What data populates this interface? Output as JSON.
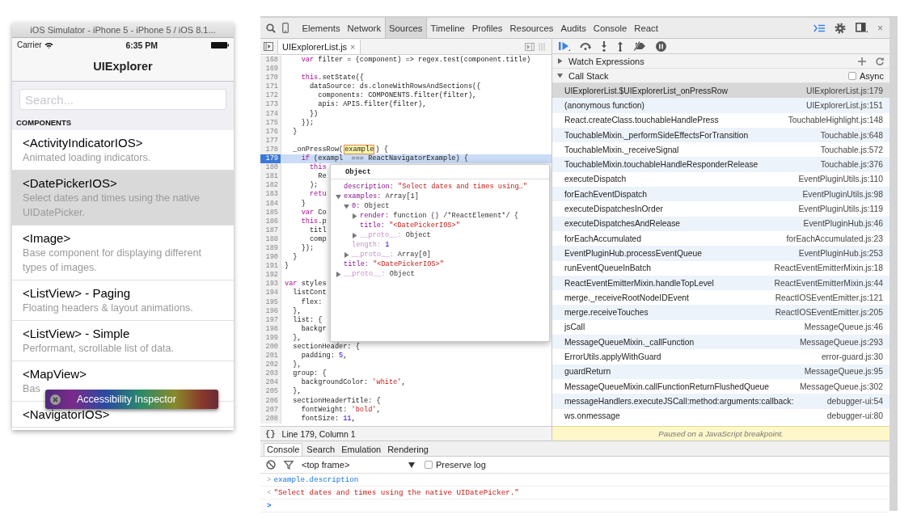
{
  "simulator": {
    "title": "iOS Simulator - iPhone 5 - iPhone 5 / iOS 8.1...",
    "status_bar": {
      "carrier": "Carrier",
      "time": "6:35 PM"
    },
    "nav_title": "UIExplorer",
    "search": {
      "placeholder": "Search..."
    },
    "section_header": "COMPONENTS",
    "items": [
      {
        "title": "<ActivityIndicatorIOS>",
        "description": "Animated loading indicators.",
        "selected": false
      },
      {
        "title": "<DatePickerIOS>",
        "description": "Select dates and times using the native UIDatePicker.",
        "selected": true
      },
      {
        "title": "<Image>",
        "description": "Base component for displaying different types of images.",
        "selected": false
      },
      {
        "title": "<ListView> - Paging",
        "description": "Floating headers & layout animations.",
        "selected": false
      },
      {
        "title": "<ListView> - Simple",
        "description": "Performant, scrollable list of data.",
        "selected": false
      },
      {
        "title": "<MapView>",
        "description": "Bas",
        "selected": false
      },
      {
        "title": "<NavigatorIOS>",
        "selected": false
      }
    ],
    "overlay": {
      "label": "Accessibility Inspector"
    }
  },
  "devtools": {
    "tabs": [
      {
        "label": "Elements",
        "selected": false
      },
      {
        "label": "Network",
        "selected": false
      },
      {
        "label": "Sources",
        "selected": true
      },
      {
        "label": "Timeline",
        "selected": false
      },
      {
        "label": "Profiles",
        "selected": false
      },
      {
        "label": "Resources",
        "selected": false
      },
      {
        "label": "Audits",
        "selected": false
      },
      {
        "label": "Console",
        "selected": false
      },
      {
        "label": "React",
        "selected": false
      }
    ],
    "close": "×",
    "file_tab": {
      "name": "UIExplorerList.js",
      "close": "×"
    },
    "editor": {
      "lines": [
        {
          "number": "168",
          "current": false,
          "tokens": [
            {
              "text": "    var",
              "kind": "keyword"
            },
            {
              "text": " filter = (component) => regex.test(component.title)",
              "kind": "plain"
            }
          ]
        },
        {
          "number": "169",
          "current": false
        },
        {
          "number": "170",
          "current": false,
          "tokens": [
            {
              "text": "    this",
              "kind": "keyword"
            },
            {
              "text": ".setState({",
              "kind": "plain"
            }
          ]
        },
        {
          "number": "171",
          "current": false,
          "tokens": [
            {
              "text": "      dataSource: ds.cloneWithRowsAndSections({",
              "kind": "plain"
            }
          ]
        },
        {
          "number": "172",
          "current": false,
          "tokens": [
            {
              "text": "        components: COMPONENTS.filter(filter),",
              "kind": "plain"
            }
          ]
        },
        {
          "number": "173",
          "current": false,
          "tokens": [
            {
              "text": "        apis: APIS.filter(filter),",
              "kind": "plain"
            }
          ]
        },
        {
          "number": "174",
          "current": false,
          "tokens": [
            {
              "text": "      })",
              "kind": "plain"
            }
          ]
        },
        {
          "number": "175",
          "current": false,
          "tokens": [
            {
              "text": "    });",
              "kind": "plain"
            }
          ]
        },
        {
          "number": "176",
          "current": false,
          "tokens": [
            {
              "text": "  }",
              "kind": "plain"
            }
          ]
        },
        {
          "number": "177",
          "current": false
        },
        {
          "number": "178",
          "current": false,
          "tokens": [
            {
              "text": "  _onPressRow(",
              "kind": "plain"
            },
            {
              "text": "example",
              "kind": "highlight"
            },
            {
              "text": ") {",
              "kind": "plain"
            }
          ]
        },
        {
          "number": "179",
          "current": true,
          "tokens": [
            {
              "text": "    if",
              "kind": "keyword"
            },
            {
              "text": " (exampl",
              "kind": "plain"
            },
            {
              "text": "  === ReactNavigatorExample) {",
              "kind": "plain"
            }
          ]
        },
        {
          "number": "180",
          "current": false,
          "tokens": [
            {
              "text": "      this",
              "kind": "keyword"
            }
          ]
        },
        {
          "number": "181",
          "current": false,
          "tokens": [
            {
              "text": "        Re",
              "kind": "plain"
            }
          ]
        },
        {
          "number": "182",
          "current": false,
          "tokens": [
            {
              "text": "      );",
              "kind": "plain"
            }
          ]
        },
        {
          "number": "183",
          "current": false,
          "tokens": [
            {
              "text": "      retu",
              "kind": "keyword"
            }
          ]
        },
        {
          "number": "184",
          "current": false,
          "tokens": [
            {
              "text": "    }",
              "kind": "plain"
            }
          ]
        },
        {
          "number": "185",
          "current": false,
          "tokens": [
            {
              "text": "    var",
              "kind": "keyword"
            },
            {
              "text": " Co",
              "kind": "plain"
            }
          ]
        },
        {
          "number": "186",
          "current": false,
          "tokens": [
            {
              "text": "    this",
              "kind": "keyword"
            },
            {
              "text": ".p",
              "kind": "plain"
            }
          ]
        },
        {
          "number": "187",
          "current": false,
          "tokens": [
            {
              "text": "      titl",
              "kind": "plain"
            }
          ]
        },
        {
          "number": "188",
          "current": false,
          "tokens": [
            {
              "text": "      comp",
              "kind": "plain"
            }
          ]
        },
        {
          "number": "189",
          "current": false,
          "tokens": [
            {
              "text": "    });",
              "kind": "plain"
            }
          ]
        },
        {
          "number": "190",
          "current": false,
          "tokens": [
            {
              "text": "  }",
              "kind": "plain"
            }
          ]
        },
        {
          "number": "191",
          "current": false,
          "tokens": [
            {
              "text": "}",
              "kind": "plain"
            }
          ]
        },
        {
          "number": "192",
          "current": false
        },
        {
          "number": "193",
          "current": false,
          "tokens": [
            {
              "text": "var",
              "kind": "keyword"
            },
            {
              "text": " styles",
              "kind": "plain"
            }
          ]
        },
        {
          "number": "194",
          "current": false,
          "tokens": [
            {
              "text": "  listCont",
              "kind": "plain"
            }
          ]
        },
        {
          "number": "195",
          "current": false,
          "tokens": [
            {
              "text": "    flex:",
              "kind": "plain"
            }
          ]
        },
        {
          "number": "196",
          "current": false,
          "tokens": [
            {
              "text": "  },",
              "kind": "plain"
            }
          ]
        },
        {
          "number": "197",
          "current": false,
          "tokens": [
            {
              "text": "  list: {",
              "kind": "plain"
            }
          ]
        },
        {
          "number": "198",
          "current": false,
          "tokens": [
            {
              "text": "    backgr",
              "kind": "plain"
            }
          ]
        },
        {
          "number": "199",
          "current": false,
          "tokens": [
            {
              "text": "  },",
              "kind": "plain"
            }
          ]
        },
        {
          "number": "200",
          "current": false,
          "tokens": [
            {
              "text": "  sectionHeader: {",
              "kind": "plain"
            }
          ]
        },
        {
          "number": "201",
          "current": false,
          "tokens": [
            {
              "text": "    padding: ",
              "kind": "plain"
            },
            {
              "text": "5",
              "kind": "number"
            },
            {
              "text": ",",
              "kind": "plain"
            }
          ]
        },
        {
          "number": "202",
          "current": false,
          "tokens": [
            {
              "text": "  },",
              "kind": "plain"
            }
          ]
        },
        {
          "number": "203",
          "current": false,
          "tokens": [
            {
              "text": "  group: {",
              "kind": "plain"
            }
          ]
        },
        {
          "number": "204",
          "current": false,
          "tokens": [
            {
              "text": "    backgroundColor: ",
              "kind": "plain"
            },
            {
              "text": "'white'",
              "kind": "string"
            },
            {
              "text": ",",
              "kind": "plain"
            }
          ]
        },
        {
          "number": "205",
          "current": false,
          "tokens": [
            {
              "text": "  },",
              "kind": "plain"
            }
          ]
        },
        {
          "number": "206",
          "current": false,
          "tokens": [
            {
              "text": "  sectionHeaderTitle: {",
              "kind": "plain"
            }
          ]
        },
        {
          "number": "207",
          "current": false,
          "tokens": [
            {
              "text": "    fontWeight: ",
              "kind": "plain"
            },
            {
              "text": "'bold'",
              "kind": "string"
            },
            {
              "text": ",",
              "kind": "plain"
            }
          ]
        },
        {
          "number": "208",
          "current": false,
          "tokens": [
            {
              "text": "    fontSize: ",
              "kind": "plain"
            },
            {
              "text": "11",
              "kind": "number"
            },
            {
              "text": ",",
              "kind": "plain"
            }
          ]
        }
      ],
      "popover": {
        "title": "Object",
        "properties": [
          {
            "name": "description:",
            "value": "\"Select dates and times using…\"",
            "kind": "string"
          },
          {
            "name": "examples:",
            "value": "Array[1]",
            "kind": "object",
            "expanded": true,
            "children": [
              {
                "name": "0:",
                "value": "Object",
                "kind": "object",
                "expanded": true,
                "children": [
                  {
                    "name": "render:",
                    "value": "function () /*ReactElement*/ {",
                    "kind": "object",
                    "expanded": false
                  },
                  {
                    "name": "title:",
                    "value": "\"<DatePickerIOS>\"",
                    "kind": "string"
                  },
                  {
                    "name": "__proto__:",
                    "value": "Object",
                    "kind": "object",
                    "expanded": false,
                    "internal": true
                  }
                ]
              },
              {
                "name": "length:",
                "value": "1",
                "kind": "number",
                "internal": true
              },
              {
                "name": "__proto__:",
                "value": "Array[0]",
                "kind": "object",
                "expanded": false,
                "internal": true
              }
            ]
          },
          {
            "name": "title:",
            "value": "\"<DatePickerIOS>\"",
            "kind": "string"
          },
          {
            "name": "__proto__:",
            "value": "Object",
            "kind": "object",
            "expanded": false,
            "internal": true
          }
        ]
      }
    },
    "status": {
      "format": "{}",
      "position": "Line 179, Column 1"
    },
    "sidebar": {
      "watch": {
        "label": "Watch Expressions",
        "expanded": false
      },
      "call_stack": {
        "label": "Call Stack",
        "expanded": true,
        "async": {
          "label": "Async",
          "checked": false
        },
        "frames": [
          {
            "function": "UIExplorerList.$UIExplorerList_onPressRow",
            "location": "UIExplorerList.js:179",
            "selected": true
          },
          {
            "function": "(anonymous function)",
            "location": "UIExplorerList.js:151",
            "selected": false
          },
          {
            "function": "React.createClass.touchableHandlePress",
            "location": "TouchableHighlight.js:148",
            "selected": false
          },
          {
            "function": "TouchableMixin._performSideEffectsForTransition",
            "location": "Touchable.js:648",
            "selected": false
          },
          {
            "function": "TouchableMixin._receiveSignal",
            "location": "Touchable.js:572",
            "selected": false
          },
          {
            "function": "TouchableMixin.touchableHandleResponderRelease",
            "location": "Touchable.js:376",
            "selected": false
          },
          {
            "function": "executeDispatch",
            "location": "EventPluginUtils.js:110",
            "selected": false
          },
          {
            "function": "forEachEventDispatch",
            "location": "EventPluginUtils.js:98",
            "selected": false
          },
          {
            "function": "executeDispatchesInOrder",
            "location": "EventPluginUtils.js:119",
            "selected": false
          },
          {
            "function": "executeDispatchesAndRelease",
            "location": "EventPluginHub.js:46",
            "selected": false
          },
          {
            "function": "forEachAccumulated",
            "location": "forEachAccumulated.js:23",
            "selected": false
          },
          {
            "function": "EventPluginHub.processEventQueue",
            "location": "EventPluginHub.js:253",
            "selected": false
          },
          {
            "function": "runEventQueueInBatch",
            "location": "ReactEventEmitterMixin.js:18",
            "selected": false
          },
          {
            "function": "ReactEventEmitterMixin.handleTopLevel",
            "location": "ReactEventEmitterMixin.js:44",
            "selected": false
          },
          {
            "function": "merge._receiveRootNodeIDEvent",
            "location": "ReactIOSEventEmitter.js:121",
            "selected": false
          },
          {
            "function": "merge.receiveTouches",
            "location": "ReactIOSEventEmitter.js:205",
            "selected": false
          },
          {
            "function": "jsCall",
            "location": "MessageQueue.js:46",
            "selected": false
          },
          {
            "function": "MessageQueueMixin._callFunction",
            "location": "MessageQueue.js:293",
            "selected": false
          },
          {
            "function": "ErrorUtils.applyWithGuard",
            "location": "error-guard.js:30",
            "selected": false
          },
          {
            "function": "guardReturn",
            "location": "MessageQueue.js:95",
            "selected": false
          },
          {
            "function": "MessageQueueMixin.callFunctionReturnFlushedQueue",
            "location": "MessageQueue.js:302",
            "selected": false
          },
          {
            "function": "messageHandlers.executeJSCall:method:arguments:callback:",
            "location": "debugger-ui:54",
            "selected": false
          },
          {
            "function": "ws.onmessage",
            "location": "debugger-ui:80",
            "selected": false
          }
        ]
      },
      "paused": "Paused on a JavaScript breakpoint."
    },
    "drawer": {
      "tabs": [
        {
          "label": "Console",
          "selected": true
        },
        {
          "label": "Search",
          "selected": false
        },
        {
          "label": "Emulation",
          "selected": false
        },
        {
          "label": "Rendering",
          "selected": false
        }
      ],
      "context": "<top frame>",
      "preserve_log": {
        "label": "Preserve log",
        "checked": false
      },
      "messages": [
        {
          "kind": "input",
          "glyph": ">",
          "text": "example.description"
        },
        {
          "kind": "output",
          "glyph": "<",
          "text": "\"Select dates and times using the native UIDatePicker.\""
        },
        {
          "kind": "prompt",
          "glyph": ">"
        }
      ]
    }
  }
}
